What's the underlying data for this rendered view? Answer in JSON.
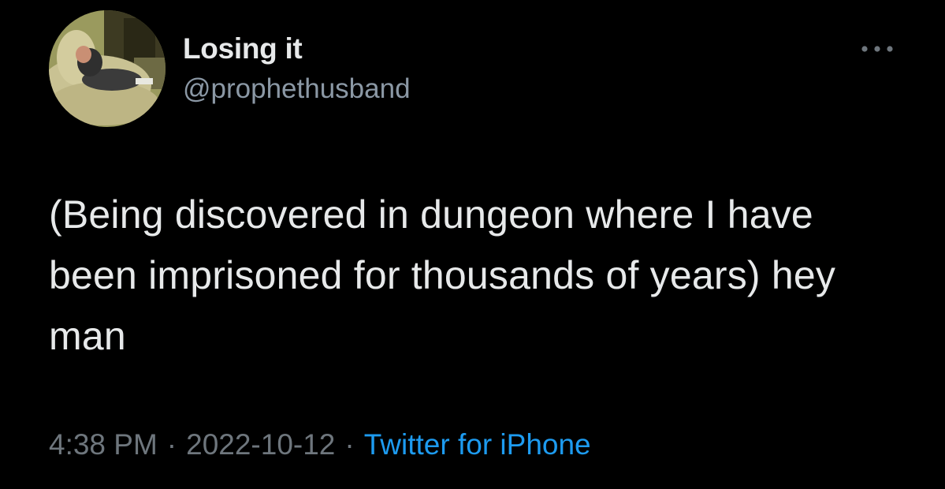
{
  "author": {
    "display_name": "Losing it",
    "handle": "@prophethusband"
  },
  "tweet": {
    "text": "(Being discovered in dungeon where I have been imprisoned for thousands of years) hey man"
  },
  "meta": {
    "time": "4:38 PM",
    "separator": "·",
    "date": "2022-10-12",
    "source": "Twitter for iPhone"
  },
  "icons": {
    "more": "more-horizontal-icon"
  },
  "colors": {
    "background": "#000000",
    "primary_text": "#e7e9ea",
    "secondary_text": "#8b98a5",
    "link": "#1d9bf0"
  }
}
